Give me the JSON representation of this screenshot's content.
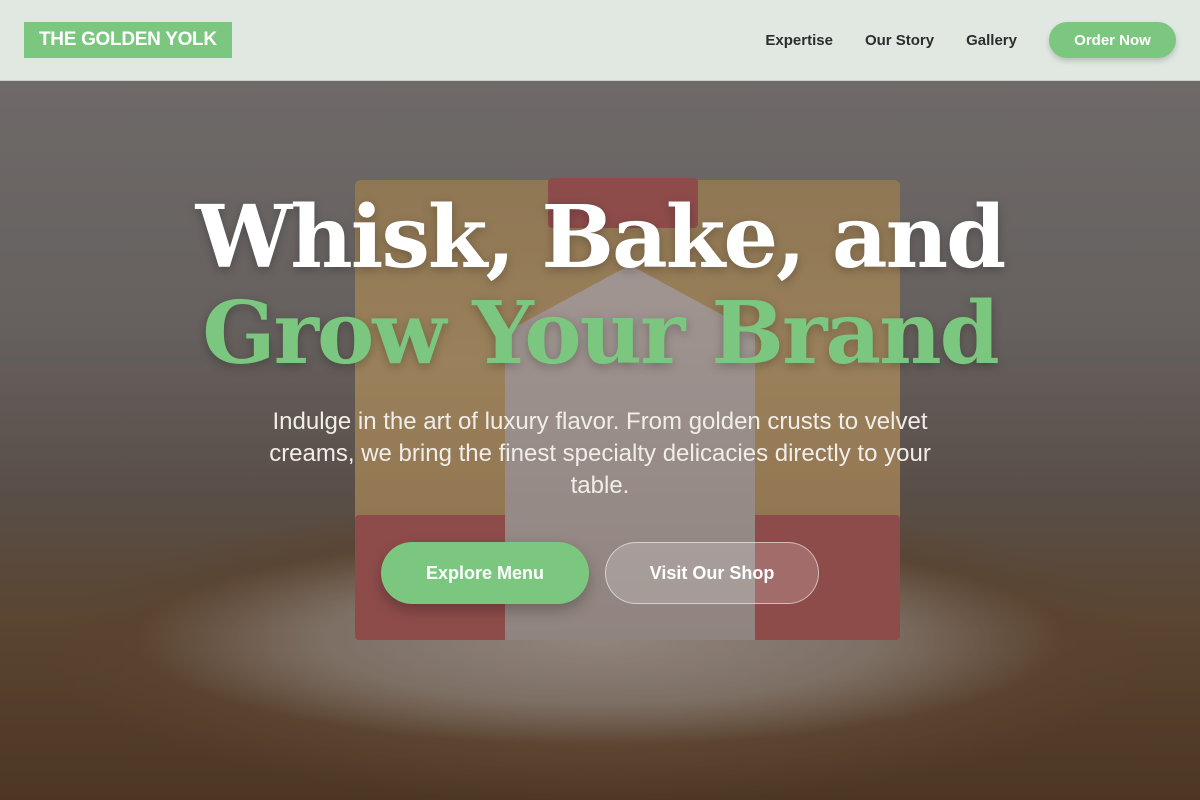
{
  "brand": {
    "logo_text": "THE GOLDEN YOLK"
  },
  "nav": {
    "links": [
      "Expertise",
      "Our Story",
      "Gallery"
    ],
    "cta_label": "Order Now"
  },
  "hero": {
    "headline_line1": "Whisk, Bake, and",
    "headline_line2": "Grow Your Brand",
    "subtext": "Indulge in the art of luxury flavor. From golden crusts to velvet creams, we bring the finest specialty delicacies directly to your table.",
    "primary_cta": "Explore Menu",
    "secondary_cta": "Visit Our Shop"
  },
  "colors": {
    "accent": "#7bc77f",
    "navbar_bg": "#e1e8e2",
    "nav_text": "#2d2d2d",
    "headline_white": "#ffffff"
  }
}
